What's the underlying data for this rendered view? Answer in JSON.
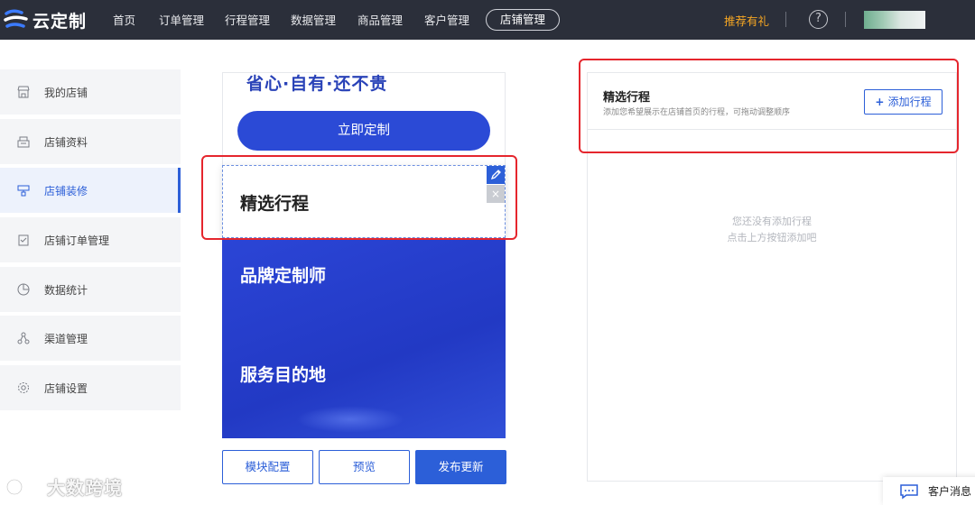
{
  "app": {
    "logo_text": "云定制",
    "nav": [
      "首页",
      "订单管理",
      "行程管理",
      "数据管理",
      "商品管理",
      "客户管理"
    ],
    "nav_active": "店铺管理",
    "promo": "推荐有礼",
    "help": "?"
  },
  "sidebar": {
    "items": [
      {
        "label": "我的店铺",
        "icon": "store-icon"
      },
      {
        "label": "店铺资料",
        "icon": "profile-icon"
      },
      {
        "label": "店铺装修",
        "icon": "brush-icon"
      },
      {
        "label": "店铺订单管理",
        "icon": "order-icon"
      },
      {
        "label": "数据统计",
        "icon": "chart-icon"
      },
      {
        "label": "渠道管理",
        "icon": "channel-icon"
      },
      {
        "label": "店铺设置",
        "icon": "gear-icon"
      }
    ],
    "active_index": 2
  },
  "preview": {
    "slogan": "省心·自有·还不贵",
    "cta": "立即定制",
    "selected_module": "精选行程",
    "close": "×",
    "block_title_1": "品牌定制师",
    "block_title_2": "服务目的地"
  },
  "actions": {
    "module_config": "模块配置",
    "preview": "预览",
    "publish": "发布更新"
  },
  "panel": {
    "title": "精选行程",
    "desc": "添加您希望展示在店铺首页的行程，可拖动调整顺序",
    "add_button": "添加行程",
    "empty_line1": "您还没有添加行程",
    "empty_line2": "点击上方按钮添加吧"
  },
  "watermark": "大数跨境",
  "chat": "客户消息",
  "colors": {
    "primary": "#2c5fd8",
    "topbar": "#2b2f3a",
    "promo": "#f5a623",
    "highlight": "#e5262d"
  }
}
